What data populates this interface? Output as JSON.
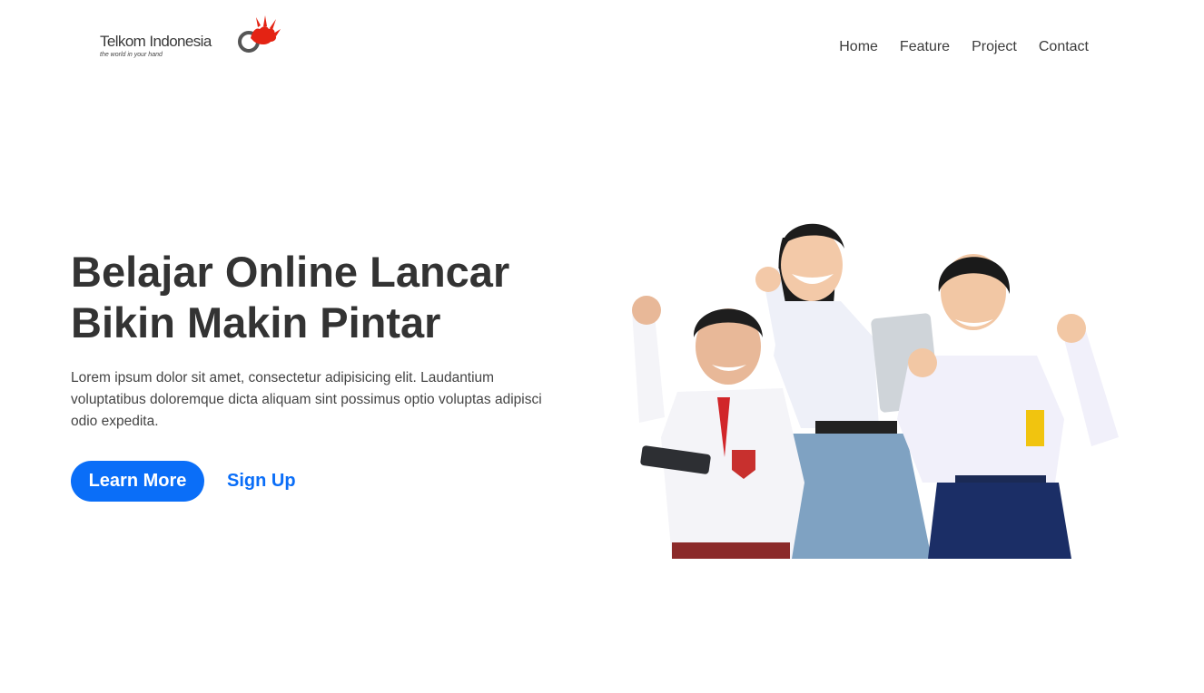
{
  "header": {
    "logo_name": "Telkom Indonesia",
    "logo_tagline": "the world in your hand",
    "nav": [
      {
        "label": "Home"
      },
      {
        "label": "Feature"
      },
      {
        "label": "Project"
      },
      {
        "label": "Contact"
      }
    ]
  },
  "hero": {
    "title_line1": "Belajar Online Lancar",
    "title_line2": "Bikin Makin Pintar",
    "description": "Lorem ipsum dolor sit amet, consectetur adipisicing elit. Laudantium voluptatibus doloremque dicta aliquam sint possimus optio voluptas adipisci odio expedita.",
    "primary_button": "Learn More",
    "secondary_link": "Sign Up"
  },
  "colors": {
    "accent": "#0a6ef8",
    "logo_red": "#e42313",
    "text_dark": "#333333"
  }
}
